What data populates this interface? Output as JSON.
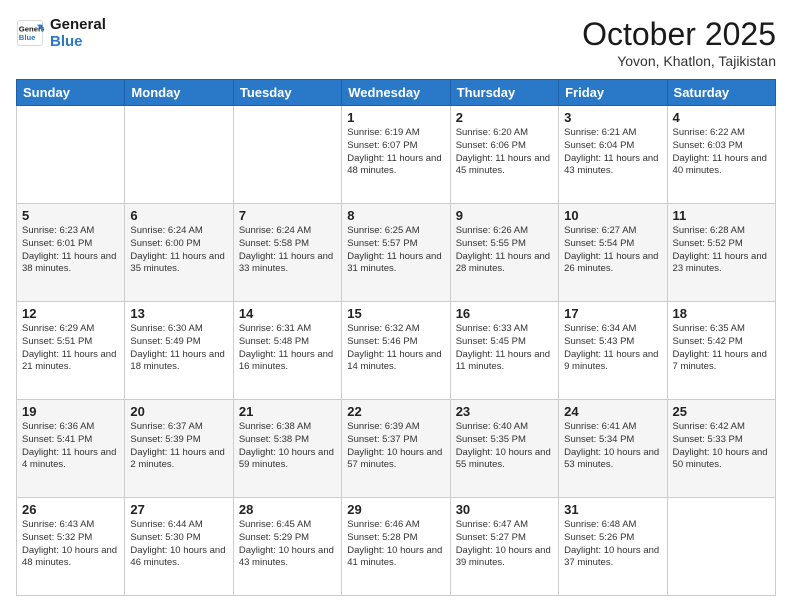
{
  "header": {
    "logo_line1": "General",
    "logo_line2": "Blue",
    "month": "October 2025",
    "location": "Yovon, Khatlon, Tajikistan"
  },
  "weekdays": [
    "Sunday",
    "Monday",
    "Tuesday",
    "Wednesday",
    "Thursday",
    "Friday",
    "Saturday"
  ],
  "weeks": [
    [
      {
        "day": "",
        "info": ""
      },
      {
        "day": "",
        "info": ""
      },
      {
        "day": "",
        "info": ""
      },
      {
        "day": "1",
        "info": "Sunrise: 6:19 AM\nSunset: 6:07 PM\nDaylight: 11 hours and 48 minutes."
      },
      {
        "day": "2",
        "info": "Sunrise: 6:20 AM\nSunset: 6:06 PM\nDaylight: 11 hours and 45 minutes."
      },
      {
        "day": "3",
        "info": "Sunrise: 6:21 AM\nSunset: 6:04 PM\nDaylight: 11 hours and 43 minutes."
      },
      {
        "day": "4",
        "info": "Sunrise: 6:22 AM\nSunset: 6:03 PM\nDaylight: 11 hours and 40 minutes."
      }
    ],
    [
      {
        "day": "5",
        "info": "Sunrise: 6:23 AM\nSunset: 6:01 PM\nDaylight: 11 hours and 38 minutes."
      },
      {
        "day": "6",
        "info": "Sunrise: 6:24 AM\nSunset: 6:00 PM\nDaylight: 11 hours and 35 minutes."
      },
      {
        "day": "7",
        "info": "Sunrise: 6:24 AM\nSunset: 5:58 PM\nDaylight: 11 hours and 33 minutes."
      },
      {
        "day": "8",
        "info": "Sunrise: 6:25 AM\nSunset: 5:57 PM\nDaylight: 11 hours and 31 minutes."
      },
      {
        "day": "9",
        "info": "Sunrise: 6:26 AM\nSunset: 5:55 PM\nDaylight: 11 hours and 28 minutes."
      },
      {
        "day": "10",
        "info": "Sunrise: 6:27 AM\nSunset: 5:54 PM\nDaylight: 11 hours and 26 minutes."
      },
      {
        "day": "11",
        "info": "Sunrise: 6:28 AM\nSunset: 5:52 PM\nDaylight: 11 hours and 23 minutes."
      }
    ],
    [
      {
        "day": "12",
        "info": "Sunrise: 6:29 AM\nSunset: 5:51 PM\nDaylight: 11 hours and 21 minutes."
      },
      {
        "day": "13",
        "info": "Sunrise: 6:30 AM\nSunset: 5:49 PM\nDaylight: 11 hours and 18 minutes."
      },
      {
        "day": "14",
        "info": "Sunrise: 6:31 AM\nSunset: 5:48 PM\nDaylight: 11 hours and 16 minutes."
      },
      {
        "day": "15",
        "info": "Sunrise: 6:32 AM\nSunset: 5:46 PM\nDaylight: 11 hours and 14 minutes."
      },
      {
        "day": "16",
        "info": "Sunrise: 6:33 AM\nSunset: 5:45 PM\nDaylight: 11 hours and 11 minutes."
      },
      {
        "day": "17",
        "info": "Sunrise: 6:34 AM\nSunset: 5:43 PM\nDaylight: 11 hours and 9 minutes."
      },
      {
        "day": "18",
        "info": "Sunrise: 6:35 AM\nSunset: 5:42 PM\nDaylight: 11 hours and 7 minutes."
      }
    ],
    [
      {
        "day": "19",
        "info": "Sunrise: 6:36 AM\nSunset: 5:41 PM\nDaylight: 11 hours and 4 minutes."
      },
      {
        "day": "20",
        "info": "Sunrise: 6:37 AM\nSunset: 5:39 PM\nDaylight: 11 hours and 2 minutes."
      },
      {
        "day": "21",
        "info": "Sunrise: 6:38 AM\nSunset: 5:38 PM\nDaylight: 10 hours and 59 minutes."
      },
      {
        "day": "22",
        "info": "Sunrise: 6:39 AM\nSunset: 5:37 PM\nDaylight: 10 hours and 57 minutes."
      },
      {
        "day": "23",
        "info": "Sunrise: 6:40 AM\nSunset: 5:35 PM\nDaylight: 10 hours and 55 minutes."
      },
      {
        "day": "24",
        "info": "Sunrise: 6:41 AM\nSunset: 5:34 PM\nDaylight: 10 hours and 53 minutes."
      },
      {
        "day": "25",
        "info": "Sunrise: 6:42 AM\nSunset: 5:33 PM\nDaylight: 10 hours and 50 minutes."
      }
    ],
    [
      {
        "day": "26",
        "info": "Sunrise: 6:43 AM\nSunset: 5:32 PM\nDaylight: 10 hours and 48 minutes."
      },
      {
        "day": "27",
        "info": "Sunrise: 6:44 AM\nSunset: 5:30 PM\nDaylight: 10 hours and 46 minutes."
      },
      {
        "day": "28",
        "info": "Sunrise: 6:45 AM\nSunset: 5:29 PM\nDaylight: 10 hours and 43 minutes."
      },
      {
        "day": "29",
        "info": "Sunrise: 6:46 AM\nSunset: 5:28 PM\nDaylight: 10 hours and 41 minutes."
      },
      {
        "day": "30",
        "info": "Sunrise: 6:47 AM\nSunset: 5:27 PM\nDaylight: 10 hours and 39 minutes."
      },
      {
        "day": "31",
        "info": "Sunrise: 6:48 AM\nSunset: 5:26 PM\nDaylight: 10 hours and 37 minutes."
      },
      {
        "day": "",
        "info": ""
      }
    ]
  ]
}
